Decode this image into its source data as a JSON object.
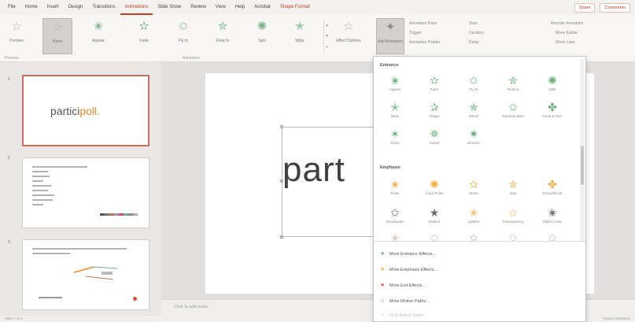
{
  "menubar": {
    "tabs": [
      "File",
      "Home",
      "Insert",
      "Design",
      "Transitions",
      "Animations",
      "Slide Show",
      "Review",
      "View",
      "Help",
      "Acrobat",
      "Shape Format"
    ],
    "active_index": 5,
    "share": "Share",
    "comments": "Comments"
  },
  "ribbon": {
    "preview": "Preview",
    "effects": [
      "None",
      "Appear",
      "Fade",
      "Fly In",
      "Float In",
      "Split",
      "Wipe"
    ],
    "effect_options": "Effect Options",
    "add_animation": "Add Animation",
    "animation_pane": "Animation Pane",
    "trigger": "Trigger",
    "animation_painter": "Animation Painter",
    "start": "Start",
    "duration": "Duration",
    "delay": "Delay",
    "reorder": "Reorder Animation",
    "move_earlier": "Move Earlier",
    "move_later": "Move Later",
    "group_preview": "Preview",
    "group_animation": "Animation"
  },
  "slides": {
    "numbers": [
      "1",
      "2",
      "3"
    ],
    "slide1_brand_main": "partici",
    "slide1_brand_accent": "poll",
    "slide1_brand_dot": "."
  },
  "slide_main": {
    "text": "part"
  },
  "notes": {
    "placeholder": "Click to add notes"
  },
  "status": {
    "left": "Slide 1 of 3",
    "right": "Notes  Comments"
  },
  "dropdown": {
    "entrance_heading": "Entrance",
    "entrance": [
      "Appear",
      "Fade",
      "Fly In",
      "Float In",
      "Split",
      "Wipe",
      "Shape",
      "Wheel",
      "Random Bars",
      "Grow & Turn",
      "Zoom",
      "Swivel",
      "Bounce"
    ],
    "emphasis_heading": "Emphasis",
    "emphasis": [
      "Pulse",
      "Color Pulse",
      "Teeter",
      "Spin",
      "Grow/Shrink",
      "Desaturate",
      "Darken",
      "Lighten",
      "Transparency",
      "Object Color"
    ],
    "menu": [
      "More Entrance Effects...",
      "More Emphasis Effects...",
      "More Exit Effects...",
      "More Motion Paths...",
      "OLE Action Verbs..."
    ]
  },
  "colors": {
    "accent": "#c43e1c",
    "entrance_icon": "#6fb27d",
    "emphasis_icon": "#f2b04a",
    "brand_orange": "#f08a24"
  }
}
